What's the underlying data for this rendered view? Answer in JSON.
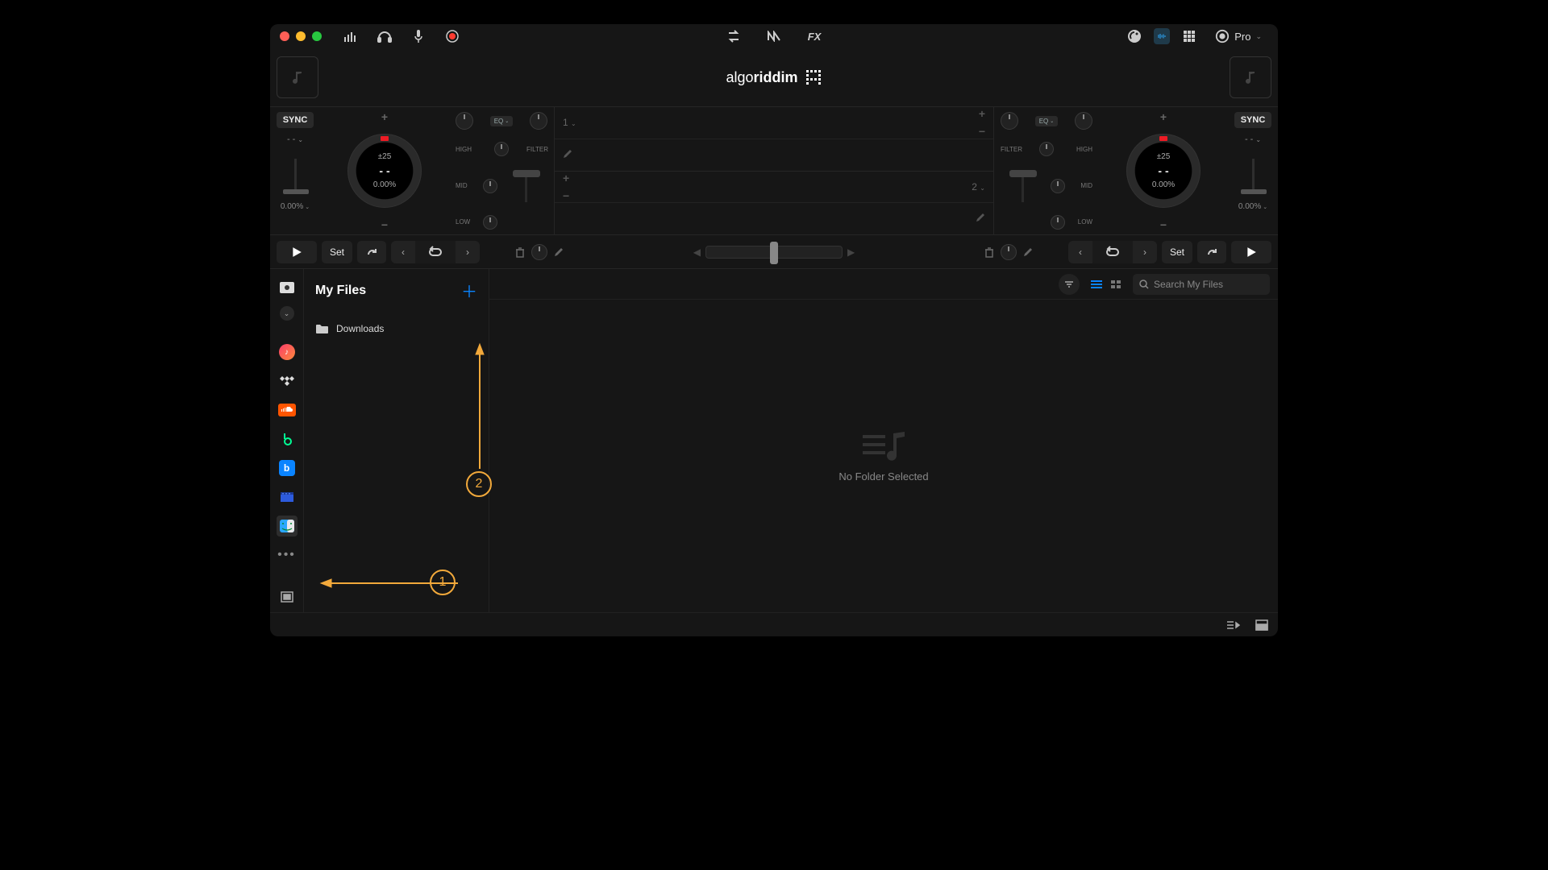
{
  "titlebar": {
    "pro_label": "Pro"
  },
  "logo": {
    "part1": "algo",
    "part2": "riddim"
  },
  "deck1": {
    "sync": "SYNC",
    "bpm_dash": "- -",
    "pitch": "±25",
    "bpm_val": "- -",
    "percent": "0.00%",
    "pct_readout": "0.00%",
    "eq_label": "EQ",
    "high": "HIGH",
    "mid": "MID",
    "low": "LOW",
    "filter": "FILTER"
  },
  "deck2": {
    "sync": "SYNC",
    "bpm_dash": "- -",
    "pitch": "±25",
    "bpm_val": "- -",
    "percent": "0.00%",
    "pct_readout": "0.00%",
    "eq_label": "EQ",
    "high": "HIGH",
    "mid": "MID",
    "low": "LOW",
    "filter": "FILTER"
  },
  "center": {
    "ch1": "1",
    "ch2": "2"
  },
  "transport": {
    "set_left": "Set",
    "set_right": "Set"
  },
  "browser": {
    "title": "My Files",
    "folder1": "Downloads",
    "search_placeholder": "Search My Files",
    "empty": "No Folder Selected"
  },
  "annotations": {
    "one": "1",
    "two": "2"
  }
}
